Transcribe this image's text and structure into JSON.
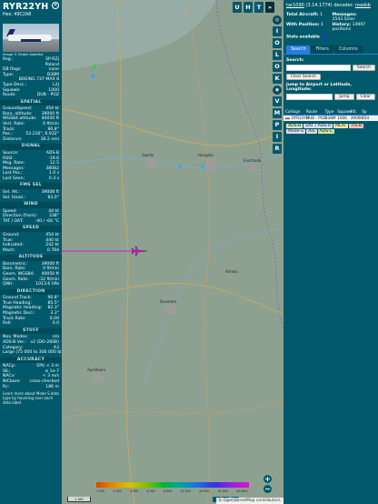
{
  "aircraft": {
    "callsign": "RYR22YH",
    "hex_label": "Hex:",
    "hex": "49C2A8",
    "photo_credit": "Image © Radim Koblížka",
    "info_rows": [
      {
        "label": "Reg.:",
        "value": "SP-RZJ"
      },
      {
        "label": "",
        "value": "Poland"
      },
      {
        "label": "DB flags:",
        "value": "none"
      },
      {
        "label": "Type:",
        "value": "B38M"
      },
      {
        "label": "",
        "value": "BOEING 737 MAX 8"
      },
      {
        "label": "Type Desc.:",
        "value": "L2J"
      },
      {
        "label": "Squawk:",
        "value": "1000"
      },
      {
        "label": "Route:",
        "value": "DUB - POZ"
      }
    ],
    "sections": [
      {
        "title": "SPATIAL",
        "rows": [
          {
            "label": "Groundspeed:",
            "value": "454 kt"
          },
          {
            "label": "Baro. altitude:",
            "value": "39000 ft"
          },
          {
            "label": "WGS84 altitude:",
            "value": "40050 ft"
          },
          {
            "label": "Vert. Rate:",
            "value": "0 ft/min"
          },
          {
            "label": "Track:",
            "value": "90.8°"
          },
          {
            "label": "Pos.:",
            "value": "53.216°, 6.932°"
          },
          {
            "label": "Distance:",
            "value": "36.2 nmi"
          }
        ]
      },
      {
        "title": "SIGNAL",
        "rows": [
          {
            "label": "Source:",
            "value": "ADS-B"
          },
          {
            "label": "RSSI:",
            "value": "-19.6"
          },
          {
            "label": "Msg. Rate:",
            "value": "12.5"
          },
          {
            "label": "Messages:",
            "value": "38082"
          },
          {
            "label": "Last Pos.:",
            "value": "1.0 s"
          },
          {
            "label": "Last Seen:",
            "value": "0.3 s"
          }
        ]
      },
      {
        "title": "FMS SEL",
        "rows": [
          {
            "label": "Sel. Alt.:",
            "value": "39008 ft"
          },
          {
            "label": "Sel. Head.:",
            "value": "83.0°"
          }
        ]
      },
      {
        "title": "WIND",
        "rows": [
          {
            "label": "Speed:",
            "value": "44 kt"
          },
          {
            "label": "Direction (from):",
            "value": "338°"
          },
          {
            "label": "TAT / OAT:",
            "value": "-40 / -66 °C"
          }
        ]
      },
      {
        "title": "SPEED",
        "rows": [
          {
            "label": "Ground:",
            "value": "454 kt"
          },
          {
            "label": "True:",
            "value": "440 kt"
          },
          {
            "label": "Indicated:",
            "value": "242 kt"
          },
          {
            "label": "Mach:",
            "value": "0.784"
          }
        ]
      },
      {
        "title": "ALTITUDE",
        "rows": [
          {
            "label": "Barometric:",
            "value": "39000 ft"
          },
          {
            "label": "Baro. Rate:",
            "value": "0 ft/min"
          },
          {
            "label": "Geom. WGS84:",
            "value": "40050 ft"
          },
          {
            "label": "Geom. Rate:",
            "value": "-32 ft/min"
          },
          {
            "label": "QNH:",
            "value": "1013.6 hPa"
          }
        ]
      },
      {
        "title": "DIRECTION",
        "rows": [
          {
            "label": "Ground Track:",
            "value": "90.8°"
          },
          {
            "label": "True Heading:",
            "value": "85.5°"
          },
          {
            "label": "Magnetic Heading:",
            "value": "82.3°"
          },
          {
            "label": "Magnetic Decl.:",
            "value": "3.3°"
          },
          {
            "label": "Track Rate:",
            "value": "0.00"
          },
          {
            "label": "Roll:",
            "value": "0.0"
          }
        ]
      },
      {
        "title": "STUFF",
        "rows": [
          {
            "label": "Nav. Modes:",
            "value": "n/a"
          },
          {
            "label": "ADS-B Ver.:",
            "value": "v2 (DO-260B)"
          },
          {
            "label": "Category:",
            "value": "A3"
          },
          {
            "label": "Large (75 000 to 300 000 lb)",
            "value": ""
          }
        ]
      },
      {
        "title": "ACCURACY",
        "rows": [
          {
            "label": "NACp:",
            "value": "EPU < 3 m"
          },
          {
            "label": "SIL:",
            "value": "≤ 1e-7"
          },
          {
            "label": "NACv:",
            "value": "< 3 m/s"
          },
          {
            "label": "NICbaro:",
            "value": "cross-checked"
          },
          {
            "label": "Rc:",
            "value": "186 m"
          }
        ]
      }
    ],
    "footer_note": "Learn more about Mode S data type by hovering over each data label."
  },
  "map": {
    "top_buttons": [
      "U",
      "H",
      "T"
    ],
    "side_buttons": [
      "I",
      "O",
      "L",
      "O",
      "K",
      "V",
      "M",
      "P",
      "I",
      "R"
    ],
    "zoom_in": "+",
    "zoom_out": "−",
    "attribution": "© OpenStreetMap contributors.",
    "scale_label": "1 NM",
    "altitude_ticks": [
      "1 000",
      "2 000",
      "4 000",
      "6 000",
      "8 000",
      "10 000",
      "20 000",
      "30 000",
      "40 000+"
    ],
    "place_labels": [
      "Zwolle",
      "Hengelo",
      "Enschede",
      "Deventer",
      "Apeldoorn",
      "Almelo"
    ],
    "accent_color": "#d01bc9"
  },
  "right_panel": {
    "brand_prefix": "tar1090",
    "brand_version": "(3.14.1774)",
    "brand_decoder_label": "decoder:",
    "brand_decoder": "readsb",
    "stats": [
      {
        "label": "Total Aircraft:",
        "value": "1"
      },
      {
        "label": "Messages:",
        "value": "1543.5/sec"
      },
      {
        "label": "With Position:",
        "value": "1"
      },
      {
        "label": "History:",
        "value": "14997 positions"
      }
    ],
    "stats_available": "Stats available",
    "tabs": [
      "Search",
      "Filters",
      "Columns"
    ],
    "search_label": "Search:",
    "search_button": "Search",
    "clear_search": "Clear Search",
    "jump_label": "Jump to Airport or Latitude, Longitude:",
    "jump_button": "Jump",
    "clear_button": "Clear",
    "columns": [
      "Callsign",
      "Route",
      "Type",
      "Squawk",
      "Alt.",
      "Sp"
    ],
    "rows": [
      {
        "callsign": "RYR22YH",
        "route": "DUB - POZ",
        "type": "B38M",
        "squawk": "1000",
        "alt": "39000",
        "sp": "454"
      }
    ],
    "legend": [
      {
        "label": "ADS-B",
        "color": "#c8e8c8"
      },
      {
        "label": "UAT / ADS-R",
        "color": "#cfe0f6"
      },
      {
        "label": "MLAT",
        "color": "#f2e6a8"
      },
      {
        "label": "TIS-B",
        "color": "#f4c8b8"
      },
      {
        "label": "Mode-S",
        "color": "#dcdcf4"
      },
      {
        "label": "AIS",
        "color": "#dcdcdc"
      },
      {
        "label": "ADS-C",
        "color": "#cde6a0"
      }
    ]
  }
}
